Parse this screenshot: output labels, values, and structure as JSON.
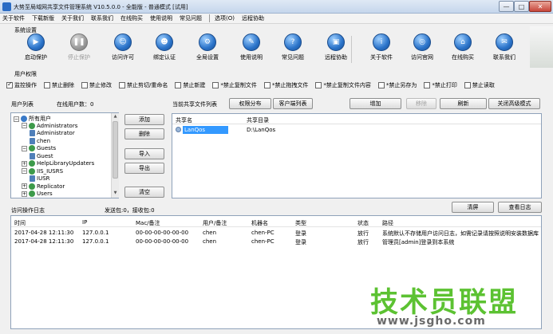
{
  "window": {
    "title": "大势至局域网共享文件管理系统 V10.5.0.0 - 全能版 - 普通模式 [试用]",
    "min_glyph": "—",
    "max_glyph": "□",
    "close_glyph": "✕"
  },
  "menu": {
    "items": [
      "关于软件",
      "下载新版",
      "关于我们",
      "联系我们",
      "在线购买",
      "使用说明",
      "常见问题"
    ],
    "items_right": [
      "选项(O)",
      "远程协助"
    ]
  },
  "system_settings": {
    "label": "系统设置",
    "buttons": [
      {
        "label": "启动保护",
        "icon": "play-icon",
        "glyph": "▶",
        "enabled": true
      },
      {
        "label": "停止保护",
        "icon": "pause-icon",
        "glyph": "❚❚",
        "enabled": false
      },
      {
        "label": "访问许可",
        "icon": "person-icon",
        "glyph": "☺",
        "enabled": true
      },
      {
        "label": "绑定认证",
        "icon": "person-icon",
        "glyph": "☻",
        "enabled": true
      },
      {
        "label": "全局设置",
        "icon": "gear-icon",
        "glyph": "⚙",
        "enabled": true
      },
      {
        "label": "使用说明",
        "icon": "graduation-cap-icon",
        "glyph": "✎",
        "enabled": true
      },
      {
        "label": "常见问题",
        "icon": "question-icon",
        "glyph": "?",
        "enabled": true
      },
      {
        "label": "远程协助",
        "icon": "monitor-icon",
        "glyph": "▣",
        "enabled": true
      },
      {
        "label": "关于软件",
        "icon": "info-icon",
        "glyph": "i",
        "enabled": true
      },
      {
        "label": "访问官网",
        "icon": "globe-icon",
        "glyph": "◎",
        "enabled": true
      },
      {
        "label": "在线购买",
        "icon": "cart-icon",
        "glyph": "⌂",
        "enabled": true
      },
      {
        "label": "联系我们",
        "icon": "contacts-icon",
        "glyph": "✉",
        "enabled": true
      }
    ]
  },
  "permissions": {
    "label": "用户权限",
    "items": [
      {
        "label": "监控操作",
        "checked": true
      },
      {
        "label": "禁止删除",
        "checked": false
      },
      {
        "label": "禁止修改",
        "checked": false
      },
      {
        "label": "禁止剪切/重命名",
        "checked": false
      },
      {
        "label": "禁止新建",
        "checked": false
      },
      {
        "label": "*禁止复制文件",
        "checked": false
      },
      {
        "label": "*禁止拖拽文件",
        "checked": false
      },
      {
        "label": "*禁止复制文件内容",
        "checked": false
      },
      {
        "label": "*禁止另存为",
        "checked": false
      },
      {
        "label": "*禁止打印",
        "checked": false
      },
      {
        "label": "禁止读取",
        "checked": false
      }
    ]
  },
  "user_list": {
    "label": "用户列表",
    "online_label": "在线用户数：0",
    "tree": [
      {
        "label": "所有用户",
        "level": 0,
        "kind": "root"
      },
      {
        "label": "Administrators",
        "level": 1,
        "kind": "group"
      },
      {
        "label": "Administrator",
        "level": 2,
        "kind": "user"
      },
      {
        "label": "chen",
        "level": 2,
        "kind": "user"
      },
      {
        "label": "Guests",
        "level": 1,
        "kind": "group"
      },
      {
        "label": "Guest",
        "level": 2,
        "kind": "user"
      },
      {
        "label": "HelpLibraryUpdaters",
        "level": 1,
        "kind": "group"
      },
      {
        "label": "IIS_IUSRS",
        "level": 1,
        "kind": "group"
      },
      {
        "label": "IUSR",
        "level": 2,
        "kind": "user"
      },
      {
        "label": "Replicator",
        "level": 1,
        "kind": "group"
      },
      {
        "label": "Users",
        "level": 1,
        "kind": "group"
      }
    ],
    "buttons": [
      "添加",
      "删除",
      "导入",
      "导出",
      "清空"
    ]
  },
  "share_list": {
    "label": "当前共享文件列表",
    "tab_permission": "权限分布",
    "tab_client": "客户端列表",
    "add_btn": "增加",
    "remove_btn": "移除",
    "refresh_btn": "刷新",
    "advanced_btn": "关闭高级模式",
    "columns": [
      "共享名",
      "共享目录"
    ],
    "rows": [
      {
        "name": "LanQos",
        "path": "D:\\LanQos"
      }
    ]
  },
  "log": {
    "label": "访问操作日志",
    "counter": "发送包:0，接收包:0",
    "clear_btn": "清屏",
    "view_btn": "查看日志",
    "columns": [
      "时间",
      "IP",
      "Mac/备注",
      "用户/备注",
      "机器名",
      "类型",
      "状态",
      "路径"
    ],
    "rows": [
      {
        "time": "2017-04-28 12:11:30",
        "ip": "127.0.0.1",
        "mac": "00-00-00-00-00-00",
        "user": "chen",
        "machine": "chen-PC",
        "type": "登录",
        "status": "放行",
        "path": "系统默认不存储用户访问日志，如需记录请按照说明安装数据库"
      },
      {
        "time": "2017-04-28 12:11:30",
        "ip": "127.0.0.1",
        "mac": "00-00-00-00-00-00",
        "user": "chen",
        "machine": "chen-PC",
        "type": "登录",
        "status": "放行",
        "path": "管理员[admin]登录到本系统"
      }
    ]
  },
  "watermark": {
    "text": "技术员联盟",
    "url": "www.jsgho.com"
  },
  "colors": {
    "accent": "#2a73c9",
    "watermark_green": "#5cc232",
    "selection": "#3399ff"
  }
}
